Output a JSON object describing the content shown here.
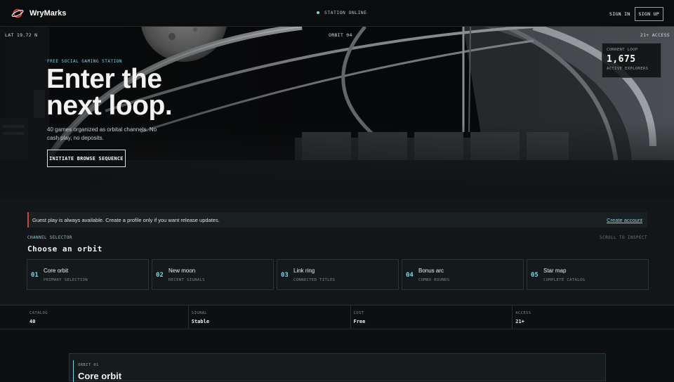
{
  "header": {
    "brand": "WryMarks",
    "status": "STATION ONLINE",
    "sign_in": "SIGN IN",
    "sign_up": "SIGN UP"
  },
  "hero": {
    "lat": "LAT 19.72 N",
    "orbit": "ORBIT 04",
    "age": "21+ ACCESS",
    "eyebrow": "FREE SOCIAL GAMING STATION",
    "title_line1": "Enter the",
    "title_line2": "next loop.",
    "subtitle": "40 games organized as orbital channels. No cash play, no deposits.",
    "cta": "INITIATE BROWSE SEQUENCE",
    "loop_card": {
      "label": "CURRENT LOOP",
      "value": "1,675",
      "foot": "ACTIVE EXPLORERS"
    }
  },
  "notice": {
    "text": "Guest play is always available. Create a profile only if you want release updates.",
    "link": "Create account"
  },
  "selector": {
    "eyebrow": "CHANNEL SELECTOR",
    "title": "Choose an orbit",
    "hint": "SCROLL TO INSPECT",
    "orbits": [
      {
        "num": "01",
        "name": "Core orbit",
        "desc": "PRIMARY SELECTION"
      },
      {
        "num": "02",
        "name": "New moon",
        "desc": "RECENT SIGNALS"
      },
      {
        "num": "03",
        "name": "Link ring",
        "desc": "CONNECTED TITLES"
      },
      {
        "num": "04",
        "name": "Bonus arc",
        "desc": "COMBO ROUNDS"
      },
      {
        "num": "05",
        "name": "Star map",
        "desc": "COMPLETE CATALOG"
      }
    ]
  },
  "stats": [
    {
      "label": "CATALOG",
      "value": "40"
    },
    {
      "label": "SIGNAL",
      "value": "Stable"
    },
    {
      "label": "COST",
      "value": "Free"
    },
    {
      "label": "ACCESS",
      "value": "21+"
    }
  ],
  "panel": {
    "eyebrow": "ORBIT 01",
    "title": "Core orbit"
  },
  "colors": {
    "accent": "#7fd4e6",
    "alert": "#c8453c",
    "logo": "#e0483c"
  }
}
